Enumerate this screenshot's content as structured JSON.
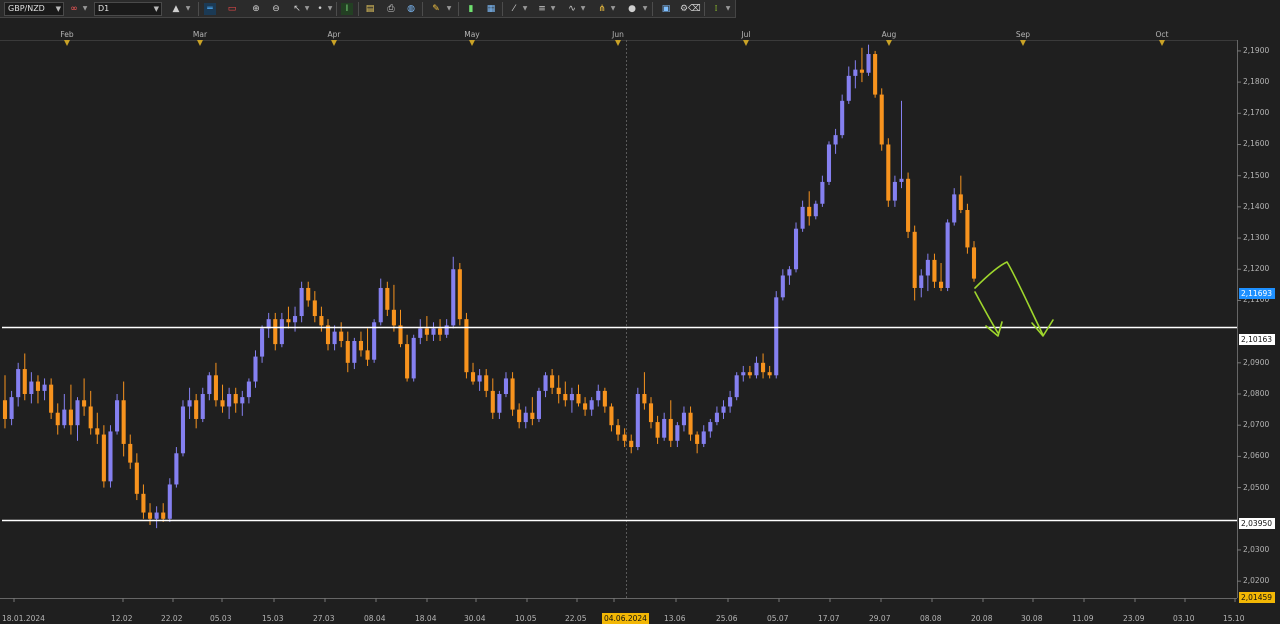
{
  "toolbar": {
    "symbol": "GBP/NZD",
    "timeframe": "D1",
    "icons": [
      "chart-type-icon",
      "indicators-icon",
      "horizontal-line-icon",
      "trendline-icon",
      "zoom-in-icon",
      "zoom-out-icon",
      "cursor-icon",
      "crosshair-icon",
      "text-tool-icon",
      "clipboard-icon",
      "print-icon",
      "globe-icon",
      "pencil-icon",
      "candle-chart-icon",
      "bar-chart-icon",
      "fibonacci-icon",
      "channel-icon",
      "wave-icon",
      "pitchfork-icon",
      "shapes-icon",
      "ellipse-icon",
      "tools-icon",
      "eraser-icon",
      "dots-icon"
    ]
  },
  "colors": {
    "background": "#1f1f1f",
    "bull_candle": "#8580f0",
    "bear_candle": "#f7931e",
    "level_line": "#ffffff",
    "annotation": "#9ed62c",
    "current_price_tag": "#1e90ff",
    "date_highlight": "#f2b705"
  },
  "chart_data": {
    "type": "candlestick",
    "symbol": "GBP/NZD",
    "timeframe": "D1",
    "month_labels": [
      "Feb",
      "Mar",
      "Apr",
      "May",
      "Jun",
      "Jul",
      "Aug",
      "Sep",
      "Oct"
    ],
    "date_labels": [
      "18.01.2024",
      "12.02",
      "22.02",
      "05.03",
      "15.03",
      "27.03",
      "08.04",
      "18.04",
      "30.04",
      "10.05",
      "22.05",
      "04.06.2024",
      "13.06",
      "25.06",
      "05.07",
      "17.07",
      "29.07",
      "08.08",
      "20.08",
      "30.08",
      "11.09",
      "23.09",
      "03.10",
      "15.10"
    ],
    "price_ticks": [
      "2,1900",
      "2,1800",
      "2,1700",
      "2,1600",
      "2,1500",
      "2,1400",
      "2,1300",
      "2,1200",
      "2,1100",
      "2,0900",
      "2,0800",
      "2,0700",
      "2,0600",
      "2,0500",
      "2,0300",
      "2,0200"
    ],
    "ylim": [
      2.0146,
      2.1935
    ],
    "horizontal_levels": [
      2.10163,
      2.0395
    ],
    "level_labels": [
      "2,10163",
      "2,03950"
    ],
    "current_price": 2.11693,
    "current_price_label": "2,11693",
    "bottom_price_label": "2,01459",
    "highlighted_date": "04.06.2024",
    "candles": [
      [
        2.078,
        2.086,
        2.069,
        2.072
      ],
      [
        2.072,
        2.081,
        2.07,
        2.079
      ],
      [
        2.079,
        2.09,
        2.076,
        2.088
      ],
      [
        2.088,
        2.093,
        2.078,
        2.08
      ],
      [
        2.08,
        2.087,
        2.077,
        2.084
      ],
      [
        2.084,
        2.086,
        2.077,
        2.081
      ],
      [
        2.081,
        2.085,
        2.078,
        2.083
      ],
      [
        2.083,
        2.085,
        2.072,
        2.074
      ],
      [
        2.074,
        2.077,
        2.067,
        2.07
      ],
      [
        2.07,
        2.08,
        2.069,
        2.075
      ],
      [
        2.075,
        2.083,
        2.067,
        2.07
      ],
      [
        2.07,
        2.079,
        2.065,
        2.078
      ],
      [
        2.078,
        2.085,
        2.073,
        2.076
      ],
      [
        2.076,
        2.081,
        2.067,
        2.069
      ],
      [
        2.069,
        2.074,
        2.064,
        2.067
      ],
      [
        2.067,
        2.07,
        2.05,
        2.052
      ],
      [
        2.052,
        2.07,
        2.05,
        2.068
      ],
      [
        2.068,
        2.08,
        2.067,
        2.078
      ],
      [
        2.078,
        2.084,
        2.06,
        2.064
      ],
      [
        2.064,
        2.067,
        2.056,
        2.058
      ],
      [
        2.058,
        2.061,
        2.046,
        2.048
      ],
      [
        2.048,
        2.051,
        2.04,
        2.042
      ],
      [
        2.042,
        2.045,
        2.038,
        2.04
      ],
      [
        2.04,
        2.044,
        2.037,
        2.042
      ],
      [
        2.042,
        2.045,
        2.039,
        2.04
      ],
      [
        2.04,
        2.053,
        2.039,
        2.051
      ],
      [
        2.051,
        2.063,
        2.05,
        2.061
      ],
      [
        2.061,
        2.078,
        2.06,
        2.076
      ],
      [
        2.076,
        2.082,
        2.072,
        2.078
      ],
      [
        2.078,
        2.08,
        2.069,
        2.072
      ],
      [
        2.072,
        2.082,
        2.071,
        2.08
      ],
      [
        2.08,
        2.087,
        2.078,
        2.086
      ],
      [
        2.086,
        2.09,
        2.076,
        2.078
      ],
      [
        2.078,
        2.083,
        2.074,
        2.076
      ],
      [
        2.076,
        2.082,
        2.072,
        2.08
      ],
      [
        2.08,
        2.082,
        2.074,
        2.077
      ],
      [
        2.077,
        2.081,
        2.073,
        2.079
      ],
      [
        2.079,
        2.085,
        2.077,
        2.084
      ],
      [
        2.084,
        2.094,
        2.082,
        2.092
      ],
      [
        2.092,
        2.102,
        2.09,
        2.101
      ],
      [
        2.101,
        2.106,
        2.098,
        2.104
      ],
      [
        2.104,
        2.106,
        2.094,
        2.096
      ],
      [
        2.096,
        2.106,
        2.095,
        2.104
      ],
      [
        2.104,
        2.108,
        2.101,
        2.103
      ],
      [
        2.103,
        2.108,
        2.1,
        2.105
      ],
      [
        2.105,
        2.116,
        2.103,
        2.114
      ],
      [
        2.114,
        2.116,
        2.108,
        2.11
      ],
      [
        2.11,
        2.113,
        2.103,
        2.105
      ],
      [
        2.105,
        2.108,
        2.1,
        2.102
      ],
      [
        2.102,
        2.104,
        2.094,
        2.096
      ],
      [
        2.096,
        2.102,
        2.094,
        2.1
      ],
      [
        2.1,
        2.103,
        2.095,
        2.097
      ],
      [
        2.097,
        2.1,
        2.087,
        2.09
      ],
      [
        2.09,
        2.098,
        2.088,
        2.097
      ],
      [
        2.097,
        2.1,
        2.092,
        2.094
      ],
      [
        2.094,
        2.101,
        2.089,
        2.091
      ],
      [
        2.091,
        2.104,
        2.09,
        2.103
      ],
      [
        2.103,
        2.117,
        2.102,
        2.114
      ],
      [
        2.114,
        2.116,
        2.105,
        2.107
      ],
      [
        2.107,
        2.115,
        2.1,
        2.102
      ],
      [
        2.102,
        2.107,
        2.095,
        2.096
      ],
      [
        2.096,
        2.099,
        2.084,
        2.085
      ],
      [
        2.085,
        2.099,
        2.084,
        2.098
      ],
      [
        2.098,
        2.104,
        2.096,
        2.101
      ],
      [
        2.101,
        2.105,
        2.097,
        2.099
      ],
      [
        2.099,
        2.103,
        2.097,
        2.101
      ],
      [
        2.101,
        2.104,
        2.097,
        2.099
      ],
      [
        2.099,
        2.104,
        2.098,
        2.102
      ],
      [
        2.102,
        2.124,
        2.101,
        2.12
      ],
      [
        2.12,
        2.122,
        2.102,
        2.104
      ],
      [
        2.104,
        2.106,
        2.085,
        2.087
      ],
      [
        2.087,
        2.09,
        2.083,
        2.084
      ],
      [
        2.084,
        2.088,
        2.081,
        2.086
      ],
      [
        2.086,
        2.088,
        2.079,
        2.081
      ],
      [
        2.081,
        2.085,
        2.072,
        2.074
      ],
      [
        2.074,
        2.081,
        2.072,
        2.08
      ],
      [
        2.08,
        2.087,
        2.079,
        2.085
      ],
      [
        2.085,
        2.087,
        2.073,
        2.075
      ],
      [
        2.075,
        2.077,
        2.069,
        2.071
      ],
      [
        2.071,
        2.076,
        2.069,
        2.074
      ],
      [
        2.074,
        2.079,
        2.07,
        2.072
      ],
      [
        2.072,
        2.082,
        2.071,
        2.081
      ],
      [
        2.081,
        2.087,
        2.079,
        2.086
      ],
      [
        2.086,
        2.088,
        2.08,
        2.082
      ],
      [
        2.082,
        2.086,
        2.077,
        2.08
      ],
      [
        2.08,
        2.084,
        2.076,
        2.078
      ],
      [
        2.078,
        2.082,
        2.074,
        2.08
      ],
      [
        2.08,
        2.083,
        2.076,
        2.077
      ],
      [
        2.077,
        2.079,
        2.073,
        2.075
      ],
      [
        2.075,
        2.079,
        2.073,
        2.078
      ],
      [
        2.078,
        2.083,
        2.076,
        2.081
      ],
      [
        2.081,
        2.082,
        2.074,
        2.076
      ],
      [
        2.076,
        2.077,
        2.068,
        2.07
      ],
      [
        2.07,
        2.072,
        2.065,
        2.067
      ],
      [
        2.067,
        2.069,
        2.063,
        2.065
      ],
      [
        2.065,
        2.067,
        2.061,
        2.063
      ],
      [
        2.063,
        2.082,
        2.062,
        2.08
      ],
      [
        2.08,
        2.087,
        2.075,
        2.077
      ],
      [
        2.077,
        2.079,
        2.069,
        2.071
      ],
      [
        2.071,
        2.073,
        2.064,
        2.066
      ],
      [
        2.066,
        2.074,
        2.065,
        2.072
      ],
      [
        2.072,
        2.078,
        2.063,
        2.065
      ],
      [
        2.065,
        2.071,
        2.063,
        2.07
      ],
      [
        2.07,
        2.076,
        2.068,
        2.074
      ],
      [
        2.074,
        2.076,
        2.065,
        2.067
      ],
      [
        2.067,
        2.068,
        2.061,
        2.064
      ],
      [
        2.064,
        2.07,
        2.063,
        2.068
      ],
      [
        2.068,
        2.072,
        2.066,
        2.071
      ],
      [
        2.071,
        2.076,
        2.07,
        2.074
      ],
      [
        2.074,
        2.078,
        2.072,
        2.076
      ],
      [
        2.076,
        2.081,
        2.074,
        2.079
      ],
      [
        2.079,
        2.087,
        2.078,
        2.086
      ],
      [
        2.086,
        2.089,
        2.084,
        2.087
      ],
      [
        2.087,
        2.089,
        2.085,
        2.086
      ],
      [
        2.086,
        2.092,
        2.085,
        2.09
      ],
      [
        2.09,
        2.093,
        2.085,
        2.087
      ],
      [
        2.087,
        2.089,
        2.085,
        2.086
      ],
      [
        2.086,
        2.113,
        2.085,
        2.111
      ],
      [
        2.111,
        2.12,
        2.11,
        2.118
      ],
      [
        2.118,
        2.121,
        2.115,
        2.12
      ],
      [
        2.12,
        2.135,
        2.119,
        2.133
      ],
      [
        2.133,
        2.142,
        2.132,
        2.14
      ],
      [
        2.14,
        2.145,
        2.134,
        2.137
      ],
      [
        2.137,
        2.142,
        2.136,
        2.141
      ],
      [
        2.141,
        2.15,
        2.14,
        2.148
      ],
      [
        2.148,
        2.161,
        2.147,
        2.16
      ],
      [
        2.16,
        2.165,
        2.157,
        2.163
      ],
      [
        2.163,
        2.176,
        2.162,
        2.174
      ],
      [
        2.174,
        2.185,
        2.173,
        2.182
      ],
      [
        2.182,
        2.187,
        2.178,
        2.184
      ],
      [
        2.184,
        2.191,
        2.18,
        2.183
      ],
      [
        2.183,
        2.192,
        2.182,
        2.189
      ],
      [
        2.189,
        2.19,
        2.175,
        2.176
      ],
      [
        2.176,
        2.178,
        2.158,
        2.16
      ],
      [
        2.16,
        2.162,
        2.14,
        2.142
      ],
      [
        2.142,
        2.15,
        2.14,
        2.148
      ],
      [
        2.148,
        2.174,
        2.146,
        2.149
      ],
      [
        2.149,
        2.151,
        2.13,
        2.132
      ],
      [
        2.132,
        2.134,
        2.11,
        2.114
      ],
      [
        2.114,
        2.12,
        2.111,
        2.118
      ],
      [
        2.118,
        2.125,
        2.113,
        2.123
      ],
      [
        2.123,
        2.125,
        2.114,
        2.116
      ],
      [
        2.116,
        2.122,
        2.113,
        2.114
      ],
      [
        2.114,
        2.136,
        2.113,
        2.135
      ],
      [
        2.135,
        2.146,
        2.134,
        2.144
      ],
      [
        2.144,
        2.15,
        2.138,
        2.139
      ],
      [
        2.139,
        2.141,
        2.125,
        2.127
      ],
      [
        2.127,
        2.129,
        2.116,
        2.117
      ]
    ]
  }
}
